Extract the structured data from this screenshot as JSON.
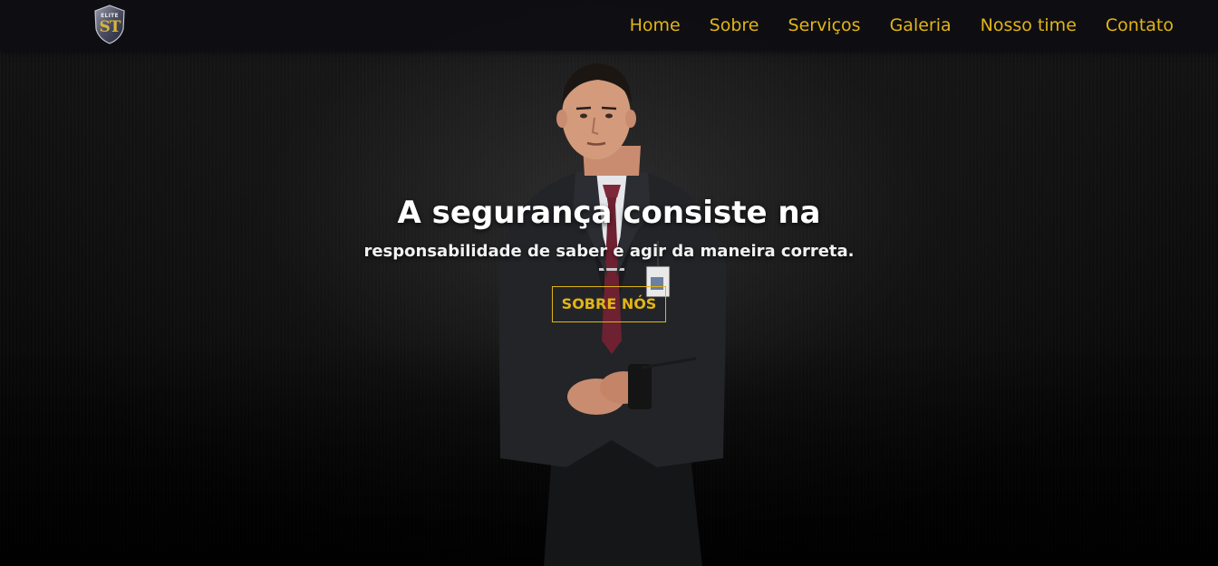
{
  "brand": {
    "logo_top_text": "ELITE",
    "logo_monogram": "ST",
    "logo_icon": "shield-logo-icon"
  },
  "nav": {
    "items": [
      {
        "label": "Home"
      },
      {
        "label": "Sobre"
      },
      {
        "label": "Serviços"
      },
      {
        "label": "Galeria"
      },
      {
        "label": "Nosso time"
      },
      {
        "label": "Contato"
      }
    ]
  },
  "hero": {
    "title": "A segurança consiste na",
    "subtitle": "responsabilidade de saber e agir da maneira correta.",
    "button_label": "SOBRE NÓS",
    "background_image": "security-guard-photo"
  },
  "colors": {
    "accent": "#e2b417",
    "navbar_bg": "#0e0e12",
    "hero_text": "#ffffff"
  }
}
